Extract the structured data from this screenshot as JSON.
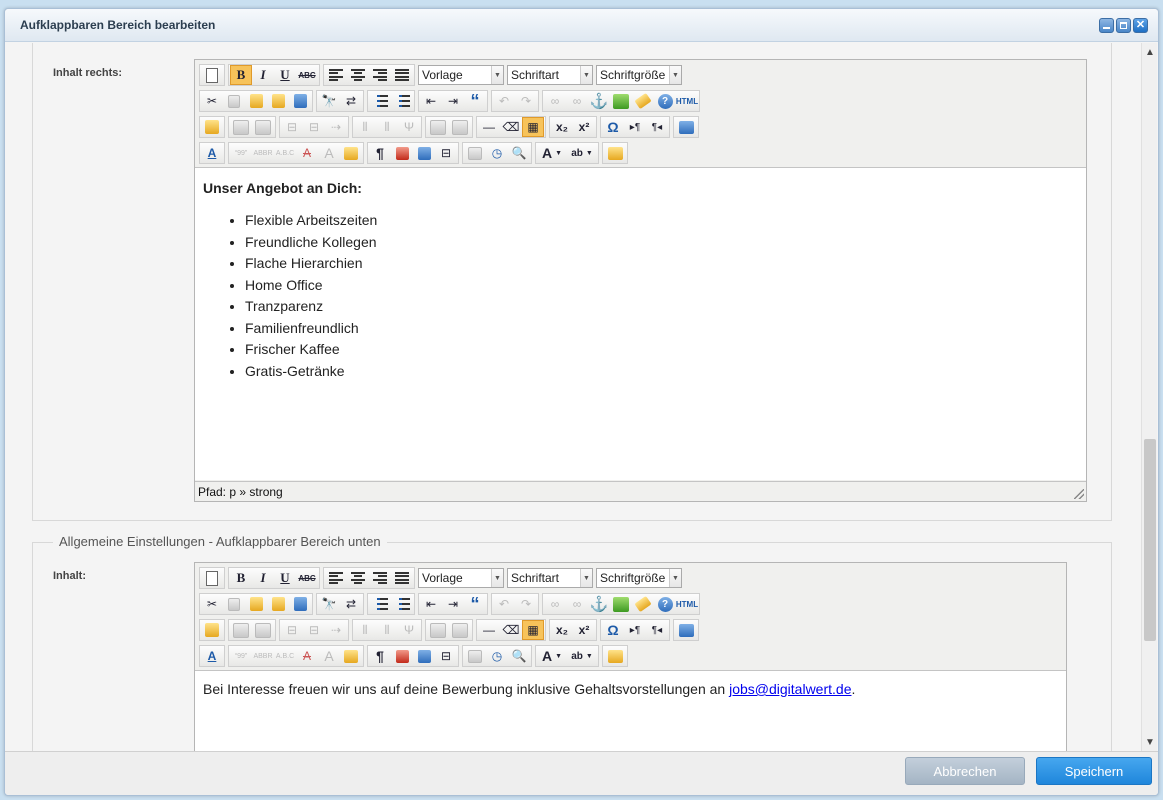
{
  "dialog": {
    "title": "Aufklappbaren Bereich bearbeiten"
  },
  "section1": {
    "field_label": "Inhalt rechts:",
    "editor": {
      "format_select": "Vorlage",
      "font_select": "Schriftart",
      "size_select": "Schriftgröße",
      "heading": "Unser Angebot an Dich:",
      "items": [
        "Flexible Arbeitszeiten",
        "Freundliche Kollegen",
        "Flache Hierarchien",
        "Home Office",
        "Tranzparenz",
        "Familienfreundlich",
        "Frischer Kaffee",
        "Gratis-Getränke"
      ],
      "path": "Pfad: p » strong"
    }
  },
  "section2": {
    "legend": "Allgemeine Einstellungen - Aufklappbarer Bereich unten",
    "field_label": "Inhalt:",
    "editor": {
      "format_select": "Vorlage",
      "font_select": "Schriftart",
      "size_select": "Schriftgröße",
      "text": "Bei Interesse freuen wir uns auf deine Bewerbung inklusive Gehaltsvorstellungen an ",
      "link": "jobs@digitalwert.de",
      "after_link": "."
    }
  },
  "footer": {
    "cancel_label": "Abbrechen",
    "save_label": "Speichern"
  },
  "icons": {
    "toolbar_row1": [
      "new-document-icon",
      "bold-icon",
      "italic-icon",
      "underline-icon",
      "strikethrough-icon",
      "align-left-icon",
      "align-center-icon",
      "align-right-icon",
      "align-justify-icon"
    ],
    "toolbar_row2": [
      "cut-icon",
      "copy-icon",
      "paste-icon",
      "paste-text-icon",
      "paste-word-icon",
      "find-icon",
      "replace-icon",
      "bullet-list-icon",
      "numbered-list-icon",
      "outdent-icon",
      "indent-icon",
      "blockquote-icon",
      "undo-icon",
      "redo-icon",
      "link-icon",
      "unlink-icon",
      "anchor-icon",
      "image-icon",
      "cleanup-icon",
      "help-icon",
      "html-source-icon"
    ],
    "toolbar_row3": [
      "edit-icon",
      "table-props-icon",
      "row-props-icon",
      "cell-props-icon",
      "col-icon",
      "hr-icon",
      "eraser-icon",
      "visual-aid-icon",
      "subscript-icon",
      "superscript-icon",
      "special-char-icon",
      "ltr-icon",
      "rtl-icon",
      "fullscreen-icon"
    ],
    "toolbar_row4": [
      "style-icon",
      "cite-icon",
      "abbr-icon",
      "acronym-icon",
      "del-icon",
      "ins-icon",
      "attribs-icon",
      "paragraph-icon",
      "nonbreaking-icon",
      "layer-icon",
      "pagebreak-icon",
      "insert-date-icon",
      "insert-time-icon",
      "preview-icon",
      "text-color-icon",
      "bg-color-icon",
      "template-icon"
    ]
  },
  "colors": {
    "save": "#1f86db",
    "cancel": "#a4b4c4",
    "active_button": "#f7c35a"
  }
}
